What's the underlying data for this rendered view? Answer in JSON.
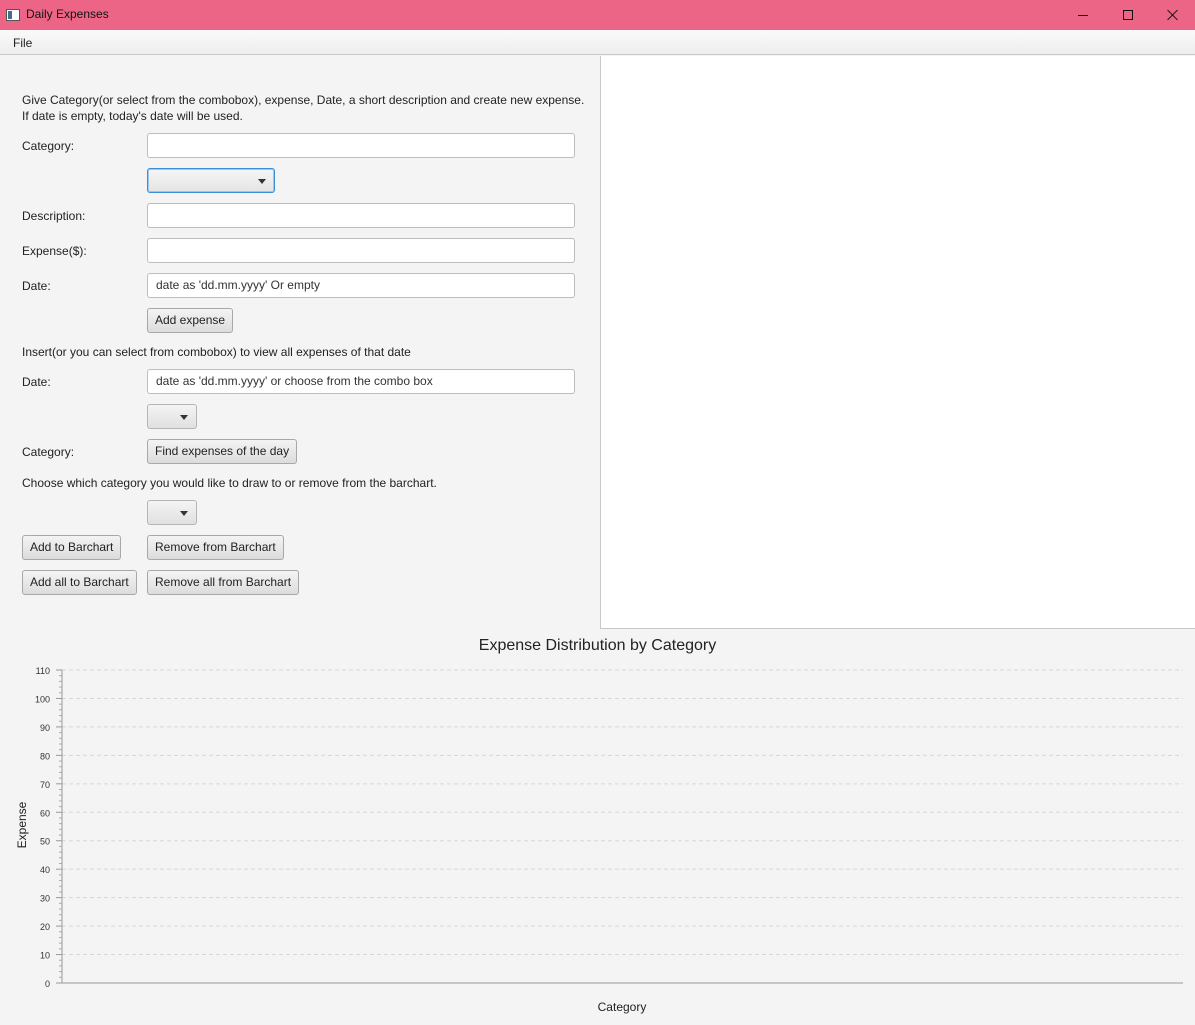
{
  "window": {
    "title": "Daily Expenses",
    "controls": [
      "minimize",
      "maximize",
      "close"
    ]
  },
  "menu": {
    "items": [
      "File"
    ]
  },
  "form": {
    "instructions": "Give Category(or select from the combobox), expense, Date, a short description and create new expense.",
    "instructions_note": "If date is empty, today's date will be used.",
    "category_label": "Category:",
    "category_value": "",
    "category_combo_value": "",
    "description_label": "Description:",
    "description_value": "",
    "expense_label": "Expense($):",
    "expense_value": "",
    "date_label": "Date:",
    "date_placeholder": "date as 'dd.mm.yyyy' Or empty",
    "add_expense_button": "Add expense"
  },
  "view": {
    "instructions": "Insert(or you can select from combobox) to view all expenses of that date",
    "date_label": "Date:",
    "date_placeholder": "date as 'dd.mm.yyyy' or choose from the combo box",
    "date_combo_value": "",
    "category_label": "Category:",
    "find_button": "Find expenses of the day"
  },
  "barchart_controls": {
    "instructions": "Choose which category you would like to draw to or remove from the barchart.",
    "category_combo_value": "",
    "add_button": "Add to Barchart",
    "remove_button": "Remove from Barchart",
    "add_all_button": "Add all to Barchart",
    "remove_all_button": "Remove all from Barchart"
  },
  "colors": {
    "titlebar": "#ec6586",
    "focus": "#3a8fd6"
  },
  "chart_data": {
    "type": "bar",
    "title": "Expense Distribution by Category",
    "xlabel": "Category",
    "ylabel": "Expense",
    "categories": [],
    "values": [],
    "ylim": [
      0,
      110
    ],
    "yticks": [
      0,
      10,
      20,
      30,
      40,
      50,
      60,
      70,
      80,
      90,
      100,
      110
    ],
    "grid": true,
    "legend": "none"
  }
}
